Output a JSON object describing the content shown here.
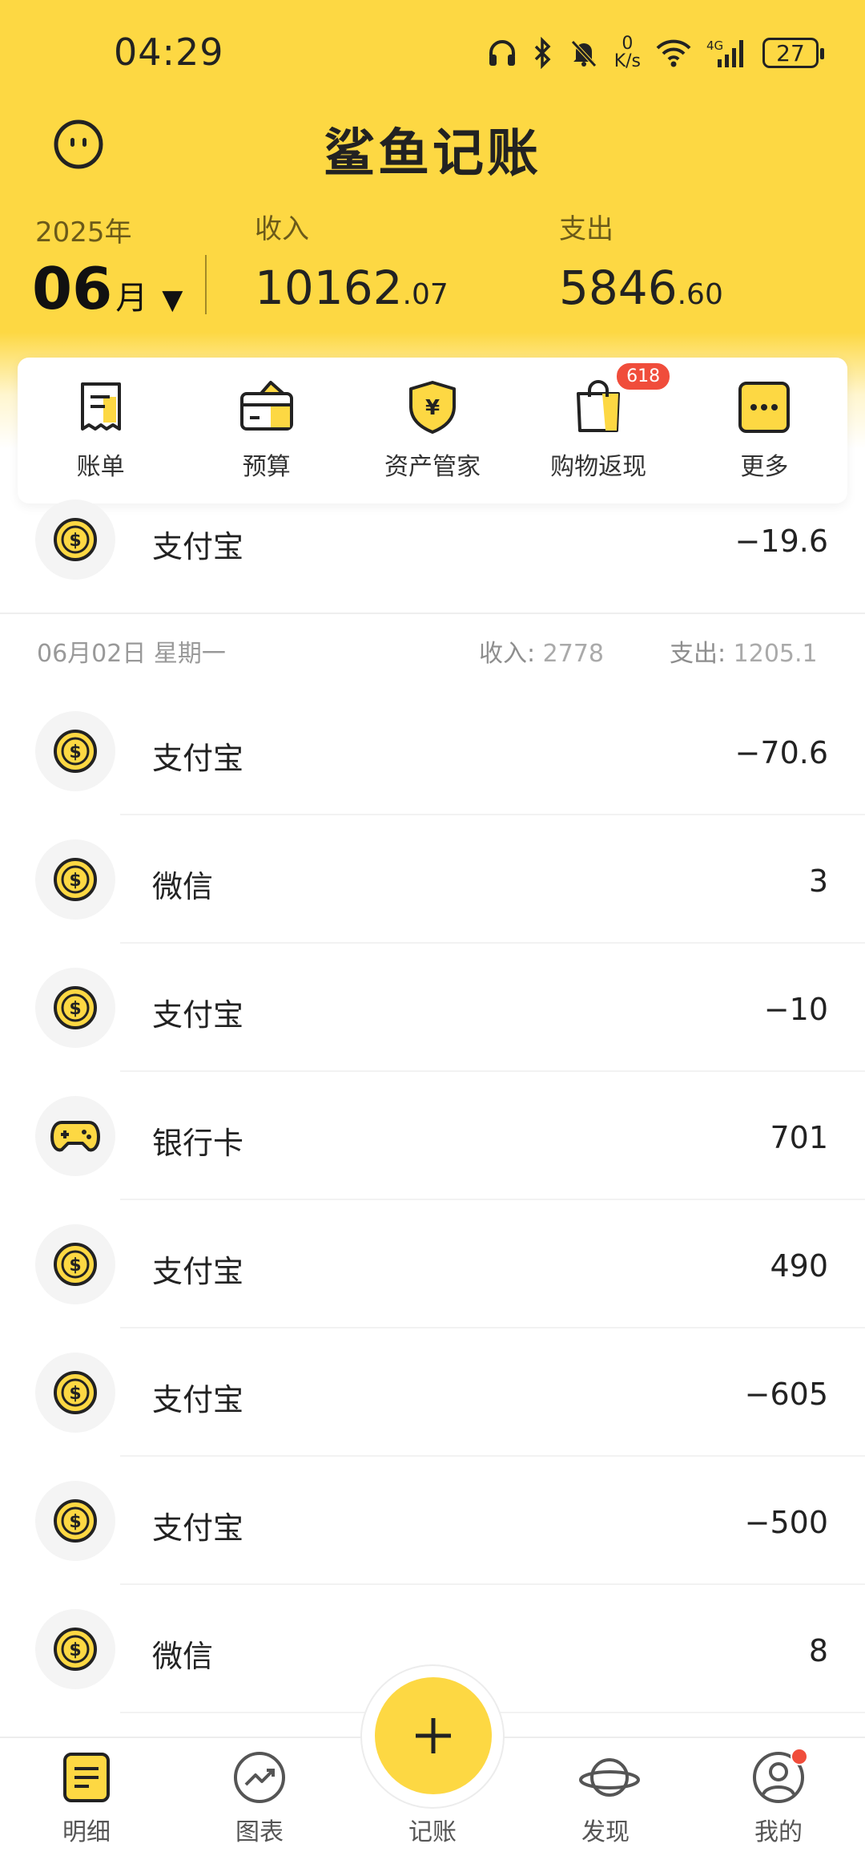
{
  "status_bar": {
    "time": "04:29",
    "net_speed_value": "0",
    "net_speed_unit": "K/s",
    "network": "4G",
    "battery": "27",
    "icons": [
      "headphones-icon",
      "bluetooth-icon",
      "mute-bell-icon",
      "wifi-icon",
      "signal-icon",
      "battery-icon"
    ]
  },
  "header": {
    "app_title": "鲨鱼记账",
    "year": "2025年",
    "month_number": "06",
    "month_unit": "月",
    "caret": "▼",
    "income_label": "收入",
    "income_int": "10162",
    "income_dec": ".07",
    "expense_label": "支出",
    "expense_int": "5846",
    "expense_dec": ".60"
  },
  "quick_menu": [
    {
      "label": "账单",
      "icon": "bill-icon"
    },
    {
      "label": "预算",
      "icon": "budget-wallet-icon"
    },
    {
      "label": "资产管家",
      "icon": "asset-shield-icon"
    },
    {
      "label": "购物返现",
      "icon": "shopping-bag-icon",
      "badge": "618"
    },
    {
      "label": "更多",
      "icon": "more-icon"
    }
  ],
  "list": {
    "top_row": {
      "name": "支付宝",
      "amount": "−19.6",
      "icon": "coin-icon"
    },
    "day_header": {
      "date": "06月02日 星期一",
      "income_label": "收入:",
      "income_value": "2778",
      "expense_label": "支出:",
      "expense_value": "1205.1"
    },
    "rows": [
      {
        "name": "支付宝",
        "amount": "−70.6",
        "icon": "coin-icon"
      },
      {
        "name": "微信",
        "amount": "3",
        "icon": "coin-icon"
      },
      {
        "name": "支付宝",
        "amount": "−10",
        "icon": "coin-icon"
      },
      {
        "name": "银行卡",
        "amount": "701",
        "icon": "gamepad-icon"
      },
      {
        "name": "支付宝",
        "amount": "490",
        "icon": "coin-icon"
      },
      {
        "name": "支付宝",
        "amount": "−605",
        "icon": "coin-icon"
      },
      {
        "name": "支付宝",
        "amount": "−500",
        "icon": "coin-icon"
      },
      {
        "name": "微信",
        "amount": "8",
        "icon": "coin-icon"
      }
    ]
  },
  "bottom_nav": [
    {
      "label": "明细",
      "icon": "detail-list-icon"
    },
    {
      "label": "图表",
      "icon": "chart-trend-icon"
    },
    {
      "label": "记账",
      "icon": "plus-icon"
    },
    {
      "label": "发现",
      "icon": "planet-icon"
    },
    {
      "label": "我的",
      "icon": "profile-icon"
    }
  ],
  "colors": {
    "brand_yellow": "#fdd843",
    "badge_red": "#f04d3b",
    "text_dark": "#222222",
    "text_muted": "#999999"
  }
}
